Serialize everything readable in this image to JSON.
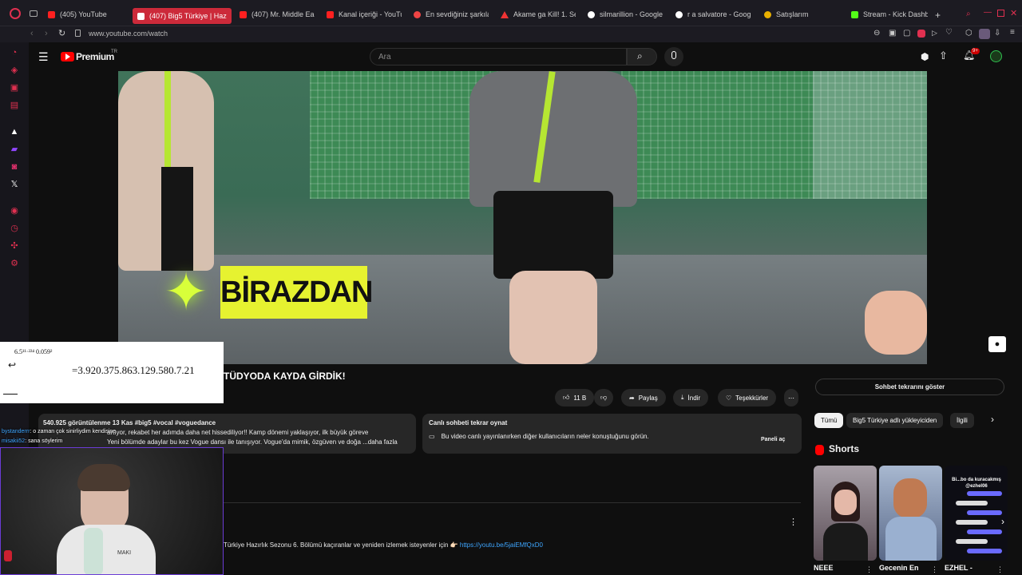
{
  "browser": {
    "tabs": [
      {
        "label": "(405) YouTube",
        "icon": "youtube-favicon"
      },
      {
        "label": "(407) Big5 Türkiye | Haz",
        "icon": "youtube-favicon",
        "active": true
      },
      {
        "label": "(407) Mr. Middle Ea",
        "icon": "youtube-favicon"
      },
      {
        "label": "Kanal içeriği - YouTu",
        "icon": "youtube-favicon"
      },
      {
        "label": "En sevdiğiniz şarkıla",
        "icon": "spotify-favicon"
      },
      {
        "label": "Akame ga Kill! 1. Sez",
        "icon": "triangle-favicon"
      },
      {
        "label": "silmarillion - Google",
        "icon": "google-favicon"
      },
      {
        "label": "r a salvatore - Googl",
        "icon": "google-favicon"
      },
      {
        "label": "Satışlarım",
        "icon": "shop-favicon"
      },
      {
        "label": "Stream - Kick Dashb",
        "icon": "kick-favicon"
      }
    ],
    "new_tab": "+",
    "url": "www.youtube.com/watch"
  },
  "youtube": {
    "logo": "Premium",
    "logo_sup": "TR",
    "search_placeholder": "Ara",
    "notification_count": "9+",
    "video": {
      "overlay_text": "BİRAZDAN",
      "title": "TÜDYODA KAYDA GİRDİK!"
    },
    "actions": {
      "likes": "11 B",
      "share": "Paylaş",
      "download": "İndir",
      "thanks": "Teşekkürler"
    },
    "description": {
      "stats": "540.925 görüntülenme  13 Kas  #big5 #vocal #voguedance",
      "line2": "artıyor, rekabet her adımda daha net hissediliyor!! Kamp dönemi yaklaşıyor, ilk büyük göreve",
      "line3": "Yeni bölümde adaylar bu kez Vogue dansı ile tanışıyor. Vogue'da mimik, özgüven ve doğa ...daha fazla"
    },
    "live_chat_replay": {
      "title": "Canlı sohbeti tekrar oynat",
      "text": "Bu video canlı yayınlanırken diğer kullanıcıların neler konuştuğunu görün.",
      "button": "Paneli aç"
    },
    "show_chat_button": "Sohbet tekrarını göster",
    "chips": [
      "Tümü",
      "Big5 Türkiye adlı yükleyiciden",
      "İlgili"
    ],
    "shorts_heading": "Shorts",
    "shorts": [
      {
        "title": "NEEE"
      },
      {
        "title": "Gecenin En"
      },
      {
        "title": "EZHEL -",
        "thumb_text": "Bi...bo da kuracakmış @ezhel06"
      }
    ],
    "comment_text": "Türkiye Hazırlık Sezonu 6. Bölümü kaçıranlar ve yeniden izlemek isteyenler için 👉🏻",
    "comment_link": "https://youtu.be/5jaiEMfQxD0"
  },
  "overlays": {
    "calculator_top": "6.5¹¹·²²⁴ 0.059²",
    "calculator_result": "=3.920.375.863.129.580.7.21",
    "stream_chat": [
      {
        "user": "bystanderrr",
        "text": ": o zaman çok sinirliydim kendisine"
      },
      {
        "user": "misakii52",
        "text": ": sana söylerim"
      }
    ],
    "webcam_shirt_text": "MAKI"
  },
  "colors": {
    "background": "#0f0f0f",
    "active_tab": "#cc2a3a",
    "accent_yellow": "#e6f230",
    "link": "#3ea6ff"
  }
}
